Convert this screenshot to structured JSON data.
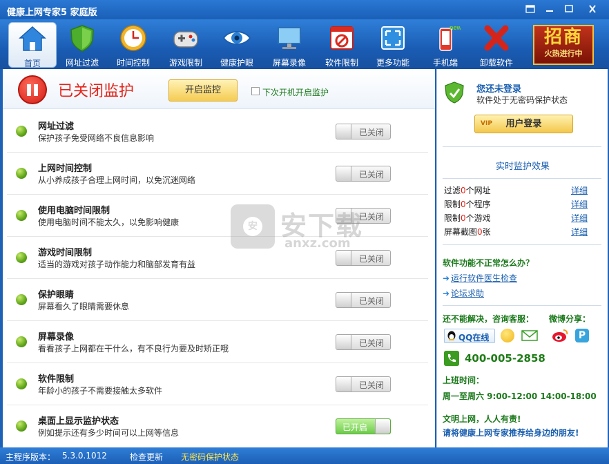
{
  "window": {
    "title": "健康上网专家5 家庭版",
    "controls": [
      "skin-icon",
      "minimize-icon",
      "maximize-icon",
      "close-icon"
    ]
  },
  "toolbar": {
    "items": [
      {
        "label": "首页",
        "icon": "home-icon",
        "active": true
      },
      {
        "label": "网址过滤",
        "icon": "shield-icon"
      },
      {
        "label": "时间控制",
        "icon": "clock-icon"
      },
      {
        "label": "游戏限制",
        "icon": "gamepad-icon"
      },
      {
        "label": "健康护眼",
        "icon": "eye-icon"
      },
      {
        "label": "屏幕录像",
        "icon": "monitor-icon"
      },
      {
        "label": "软件限制",
        "icon": "software-icon"
      },
      {
        "label": "更多功能",
        "icon": "expand-icon"
      },
      {
        "label": "手机端",
        "icon": "phone-icon",
        "badge": "new"
      },
      {
        "label": "卸载软件",
        "icon": "uninstall-icon"
      }
    ],
    "promo": {
      "big": "招商",
      "small": "火热进行中"
    }
  },
  "status_panel": {
    "title": "已关闭监护",
    "start_button": "开启监控",
    "autostart_label": "下次开机开启监护",
    "autostart_checked": false
  },
  "features": [
    {
      "name": "网址过滤",
      "desc": "保护孩子免受网络不良信息影响",
      "toggle": "已关闭",
      "on": false
    },
    {
      "name": "上网时间控制",
      "desc": "从小养成孩子合理上网时间，以免沉迷网络",
      "toggle": "已关闭",
      "on": false
    },
    {
      "name": "使用电脑时间限制",
      "desc": "使用电脑时间不能太久，以免影响健康",
      "toggle": "已关闭",
      "on": false
    },
    {
      "name": "游戏时间限制",
      "desc": "适当的游戏对孩子动作能力和脑部发育有益",
      "toggle": "已关闭",
      "on": false
    },
    {
      "name": "保护眼睛",
      "desc": "屏幕看久了眼睛需要休息",
      "toggle": "已关闭",
      "on": false
    },
    {
      "name": "屏幕录像",
      "desc": "看看孩子上网都在干什么，有不良行为要及时矫正哦",
      "toggle": "已关闭",
      "on": false
    },
    {
      "name": "软件限制",
      "desc": "年龄小的孩子不需要接触太多软件",
      "toggle": "已关闭",
      "on": false
    },
    {
      "name": "桌面上显示监护状态",
      "desc": "例如提示还有多少时间可以上网等信息",
      "toggle": "已开启",
      "on": true
    }
  ],
  "sidebar": {
    "login_title": "您还未登录",
    "login_sub": "软件处于无密码保护状态",
    "vip": "VIP",
    "login_button": "用户登录",
    "realtime_title": "实时监护效果",
    "stats": [
      {
        "pre": "过滤",
        "num": "0",
        "post": "个网址",
        "link": "详细"
      },
      {
        "pre": "限制",
        "num": "0",
        "post": "个程序",
        "link": "详细"
      },
      {
        "pre": "限制",
        "num": "0",
        "post": "个游戏",
        "link": "详细"
      },
      {
        "pre": "屏幕截图",
        "num": "0",
        "post": "张",
        "link": "详细"
      }
    ],
    "help_title": "软件功能不正常怎么办？",
    "links": [
      "运行软件医生检查",
      "论坛求助"
    ],
    "service_title": "还不能解决，咨询客服：",
    "share_title": "微博分享：",
    "qq_label": "QQ在线",
    "phone": "400-005-2858",
    "hours_title": "上班时间：",
    "hours": "周一至周六 9:00-12:00 14:00-18:00",
    "slogan1": "文明上网，人人有责!",
    "slogan2": "请将健康上网专家推荐给身边的朋友!"
  },
  "statusbar": {
    "version_label": "主程序版本：",
    "version": "5.3.0.1012",
    "update": "检查更新",
    "protect": "无密码保护状态"
  },
  "watermark": {
    "big": "安下载",
    "small": "anxz.com",
    "bag": "安"
  },
  "colors": {
    "accent": "#1e62b5",
    "alert": "#e5231a",
    "ok": "#1c7a1c",
    "link": "#1a5fb0"
  }
}
